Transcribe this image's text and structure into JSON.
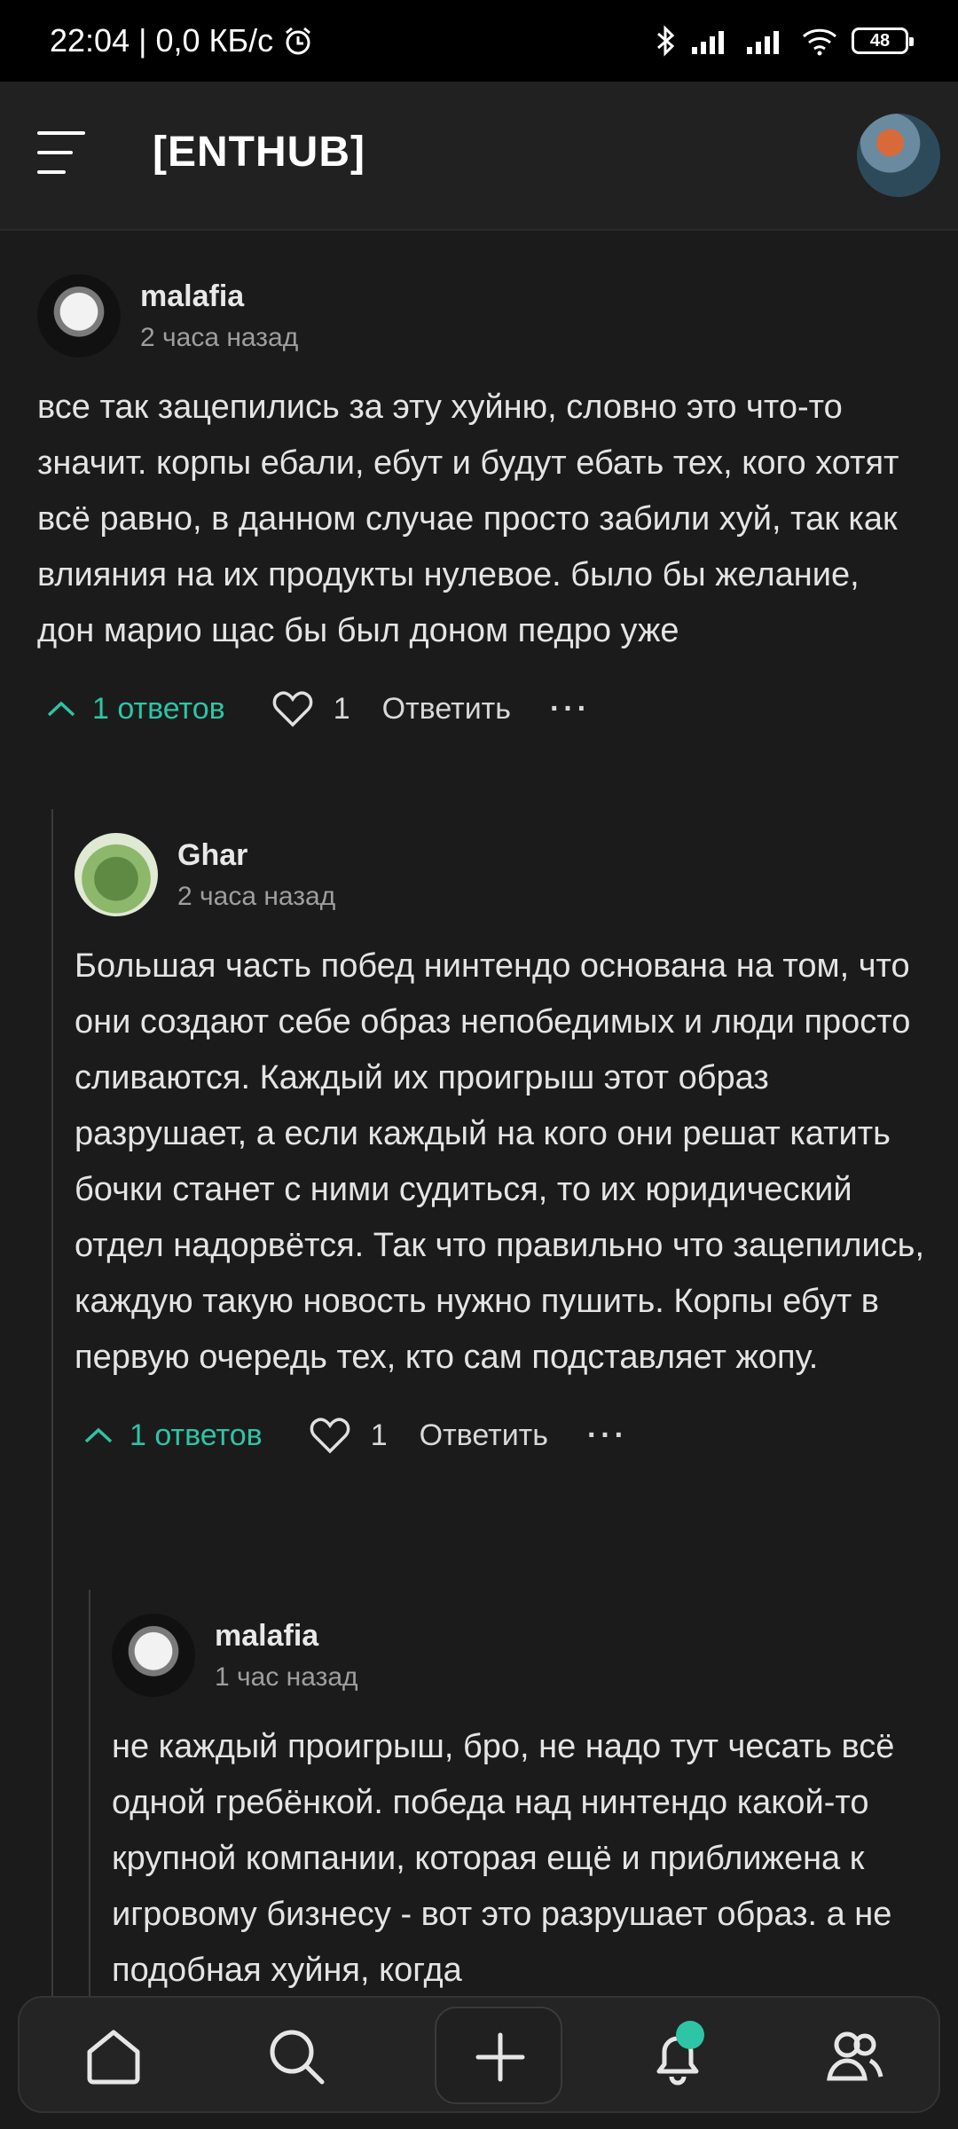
{
  "status_bar": {
    "time": "22:04",
    "net": "| 0,0 КБ/с",
    "battery": "48"
  },
  "header": {
    "logo": "[ENTHUB]"
  },
  "comments": [
    {
      "author": "malafia",
      "time": "2 часа назад",
      "text": "все так зацепились за эту хуйню, словно это что-то значит. корпы ебали, ебут и будут ебать тех, кого хотят всё равно, в данном случае просто забили хуй, так как влияния на их продукты нулевое. было бы желание, дон марио щас бы был доном педро уже",
      "replies": "1 ответов",
      "likes": "1",
      "reply": "Ответить",
      "more": "···"
    },
    {
      "author": "Ghar",
      "time": "2 часа назад",
      "text": "Большая часть побед нинтендо основана на том, что они создают себе образ непобедимых и люди просто сливаются. Каждый их проигрыш этот образ разрушает, а если каждый на кого они решат катить бочки станет с ними судиться, то их юридический отдел надорвётся. Так что правильно что зацепились, каждую такую новость нужно пушить. Корпы ебут в первую очередь тех, кто сам подставляет жопу.",
      "replies": "1 ответов",
      "likes": "1",
      "reply": "Ответить",
      "more": "···"
    },
    {
      "author": "malafia",
      "time": "1 час назад",
      "text": "не каждый проигрыш, бро, не надо тут чесать всё одной гребёнкой. победа над нинтендо какой-то крупной компании, которая ещё и приближена к игровому бизнесу - вот это разрушает образ. а не подобная хуйня, когда"
    }
  ],
  "colors": {
    "accent": "#2ec4a6",
    "background": "#1b1b1b",
    "header_bg": "#212121"
  }
}
